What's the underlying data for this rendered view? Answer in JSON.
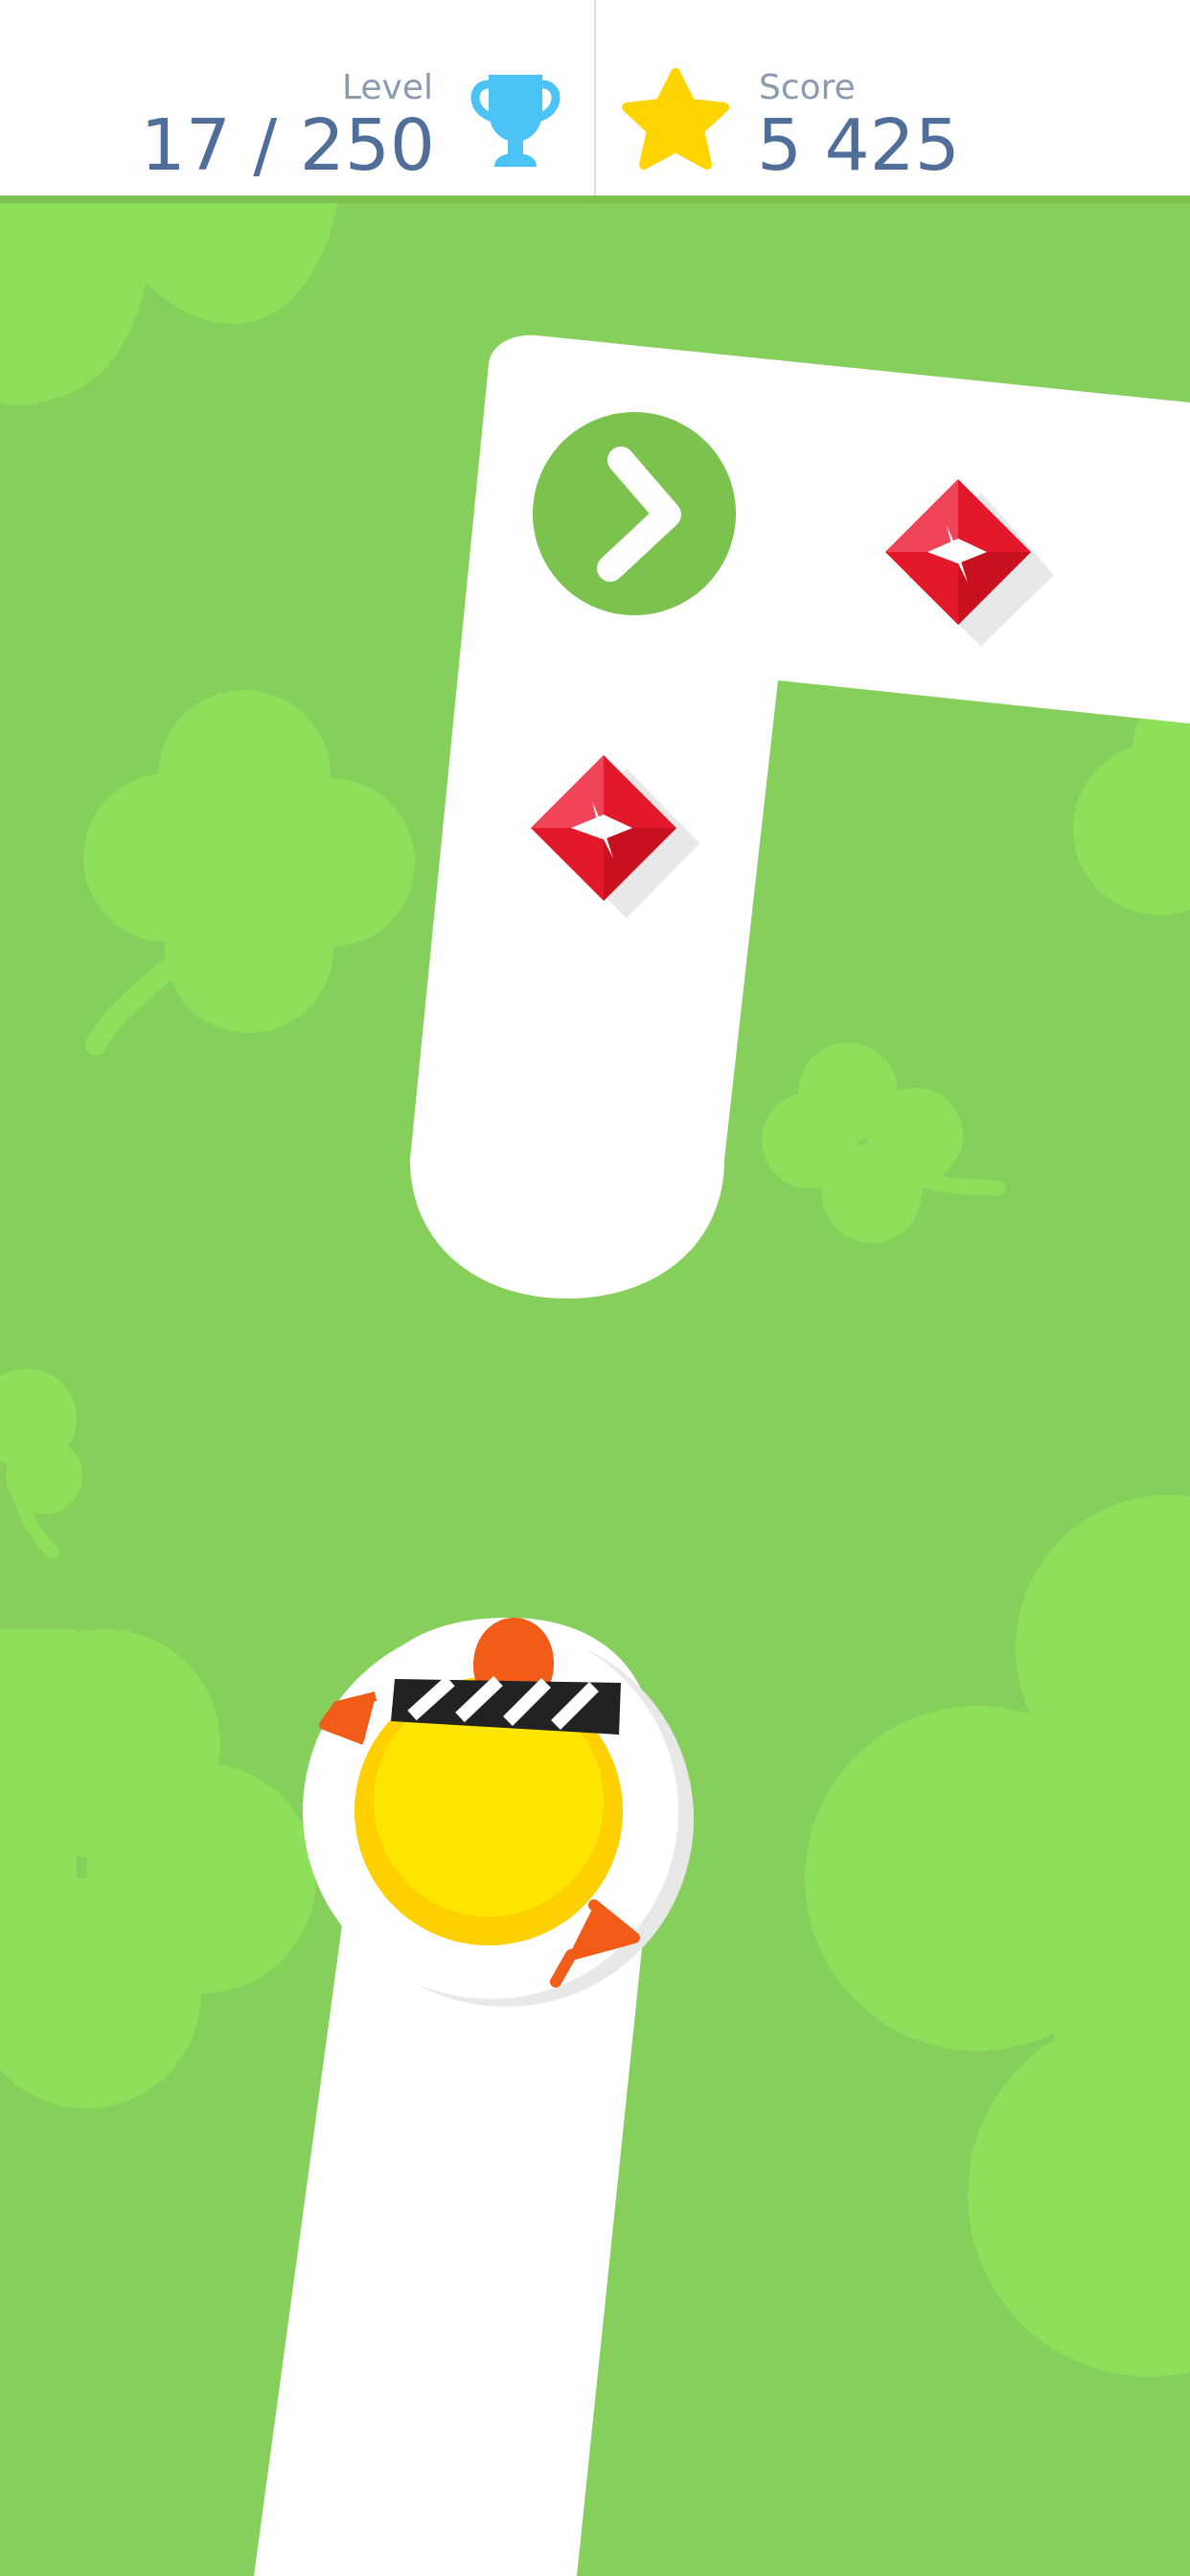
{
  "hud": {
    "level_label": "Level",
    "level_value": "17 / 250",
    "score_label": "Score",
    "score_value": "5 425",
    "level_icon": "trophy-icon",
    "score_icon": "star-icon"
  },
  "colors": {
    "background": "#86cf5c",
    "clover": "#8edf5a",
    "path": "#ffffff",
    "hud_text": "#4f6e99",
    "hud_label": "#8a9bb0",
    "trophy": "#4cc3f5",
    "star": "#ffd400",
    "gem": "#e3192b",
    "checkpoint": "#7cc24f",
    "chick_body": "#ffe600",
    "chick_feet": "#f25c19"
  },
  "game": {
    "checkpoint_icon": "chevron-right-icon",
    "gems": [
      "gem-icon",
      "gem-icon"
    ],
    "player": "chick-character"
  }
}
